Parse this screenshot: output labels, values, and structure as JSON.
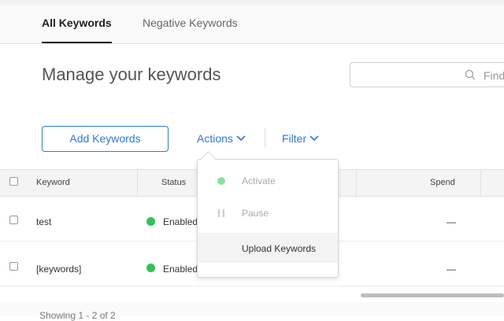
{
  "tabs": [
    {
      "label": "All Keywords"
    },
    {
      "label": "Negative Keywords"
    }
  ],
  "page_title": "Manage your keywords",
  "search": {
    "placeholder": "Find"
  },
  "toolbar": {
    "add_label": "Add Keywords",
    "actions_label": "Actions",
    "filter_label": "Filter"
  },
  "table": {
    "columns": [
      "Keyword",
      "Status",
      "Spend"
    ],
    "rows": [
      {
        "keyword": "test",
        "status": "Enabled",
        "spend": "—"
      },
      {
        "keyword": "[keywords]",
        "status": "Enabled",
        "spend": "—"
      }
    ]
  },
  "actions_menu": {
    "items": [
      {
        "label": "Activate",
        "icon": "active-dot-icon",
        "disabled": true
      },
      {
        "label": "Pause",
        "icon": "pause-icon",
        "disabled": true
      },
      {
        "label": "Upload Keywords",
        "disabled": false
      }
    ]
  },
  "footer": {
    "showing_text": "Showing 1 - 2 of 2"
  },
  "colors": {
    "accent": "#2d7ad6",
    "status_enabled": "#33c05a"
  }
}
